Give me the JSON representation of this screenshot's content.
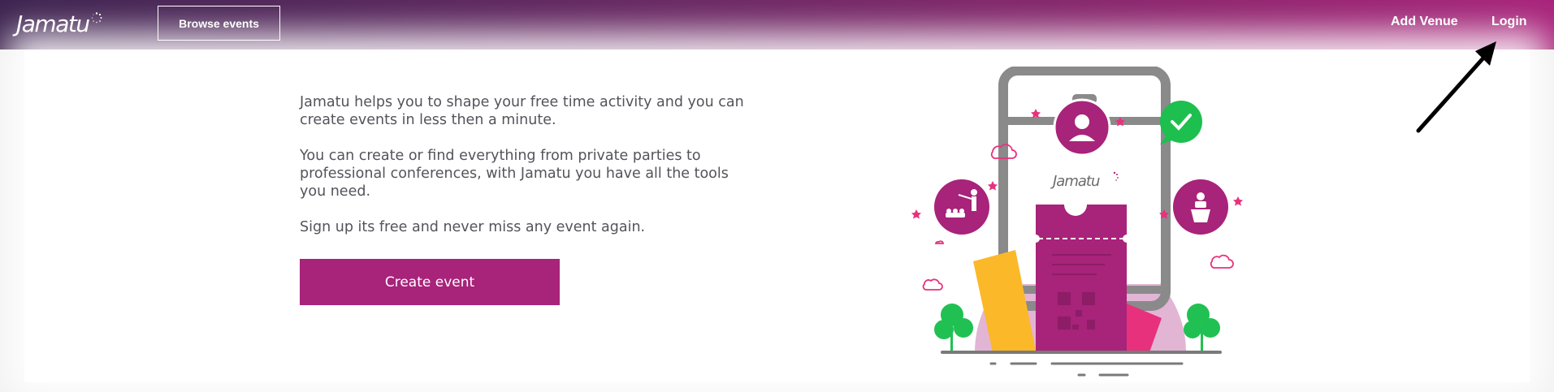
{
  "header": {
    "logo_text": "Jamatu",
    "browse_label": "Browse events",
    "add_venue_label": "Add Venue",
    "login_label": "Login"
  },
  "intro": {
    "paragraph1": "Jamatu helps you to shape your free time activity and you can create events in less then a minute.",
    "paragraph2": "You can create or find everything from private parties to professional conferences, with Jamatu you have all the tools you need.",
    "paragraph3": "Sign up its free and never miss any event again."
  },
  "cta": {
    "create_label": "Create event"
  },
  "illustration": {
    "phone_logo_text": "Jamatu",
    "icons": [
      "user-icon",
      "checkmark-icon",
      "presenter-icon",
      "speaker-podium-icon",
      "ticket-icon",
      "qr-code-icon",
      "tree-icon",
      "cloud-icon",
      "star-icon"
    ]
  },
  "annotation": {
    "icon": "arrow-pointer-icon"
  },
  "colors": {
    "brand": "#a8237a",
    "header_start": "#3d2350",
    "header_end": "#a8237a",
    "ticket_yellow": "#fbb829",
    "ticket_pink": "#e8317c",
    "check_green": "#1dbf4f",
    "tree_green": "#20c152"
  }
}
